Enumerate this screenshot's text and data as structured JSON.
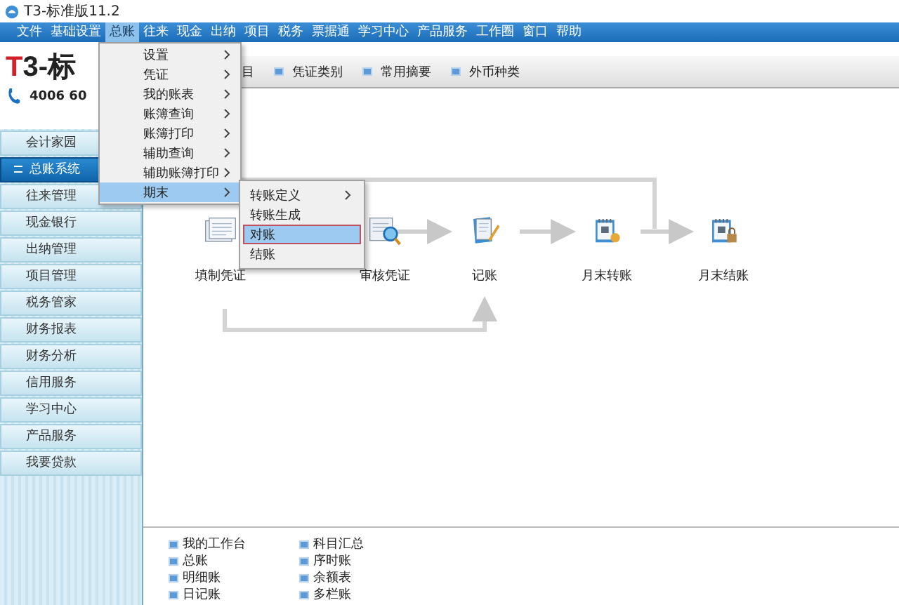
{
  "window": {
    "title": "T3-标准版11.2"
  },
  "menu_bar": [
    {
      "label": "文件",
      "selected": false
    },
    {
      "label": "基础设置",
      "selected": false
    },
    {
      "label": "总账",
      "selected": true
    },
    {
      "label": "往来",
      "selected": false
    },
    {
      "label": "现金",
      "selected": false
    },
    {
      "label": "出纳",
      "selected": false
    },
    {
      "label": "项目",
      "selected": false
    },
    {
      "label": "税务",
      "selected": false
    },
    {
      "label": "票据通",
      "selected": false
    },
    {
      "label": "学习中心",
      "selected": false
    },
    {
      "label": "产品服务",
      "selected": false
    },
    {
      "label": "工作圈",
      "selected": false
    },
    {
      "label": "窗口",
      "selected": false
    },
    {
      "label": "帮助",
      "selected": false
    }
  ],
  "header": {
    "logo_mark": "T",
    "logo_text": "3-标",
    "phone": "4006 60"
  },
  "toolbar": [
    {
      "label": "目",
      "bullet": false
    },
    {
      "label": "凭证类别",
      "bullet": true
    },
    {
      "label": "常用摘要",
      "bullet": true
    },
    {
      "label": "外币种类",
      "bullet": true
    }
  ],
  "sidebar": {
    "items": [
      {
        "label": "会计家园",
        "selected": false
      },
      {
        "label": "总账系统",
        "selected": true
      },
      {
        "label": "往来管理",
        "selected": false
      },
      {
        "label": "现金银行",
        "selected": false
      },
      {
        "label": "出纳管理",
        "selected": false
      },
      {
        "label": "项目管理",
        "selected": false
      },
      {
        "label": "税务管家",
        "selected": false
      },
      {
        "label": "财务报表",
        "selected": false
      },
      {
        "label": "财务分析",
        "selected": false
      },
      {
        "label": "信用服务",
        "selected": false
      },
      {
        "label": "学习中心",
        "selected": false
      },
      {
        "label": "产品服务",
        "selected": false
      },
      {
        "label": "我要贷款",
        "selected": false
      }
    ]
  },
  "dropdown": {
    "items": [
      {
        "label": "设置",
        "has_submenu": true,
        "selected": false
      },
      {
        "label": "凭证",
        "has_submenu": true,
        "selected": false
      },
      {
        "label": "我的账表",
        "has_submenu": true,
        "selected": false
      },
      {
        "label": "账簿查询",
        "has_submenu": true,
        "selected": false
      },
      {
        "label": "账簿打印",
        "has_submenu": true,
        "selected": false
      },
      {
        "label": "辅助查询",
        "has_submenu": true,
        "selected": false
      },
      {
        "label": "辅助账簿打印",
        "has_submenu": true,
        "selected": false
      },
      {
        "label": "期末",
        "has_submenu": true,
        "selected": true
      }
    ]
  },
  "submenu": {
    "items": [
      {
        "label": "转账定义",
        "has_submenu": true,
        "selected": false
      },
      {
        "label": "转账生成",
        "has_submenu": false,
        "selected": false
      },
      {
        "label": "对账",
        "has_submenu": false,
        "selected": true
      },
      {
        "label": "结账",
        "has_submenu": false,
        "selected": false
      }
    ]
  },
  "flow": {
    "nodes": [
      {
        "label": "填制凭证",
        "kind": "document"
      },
      {
        "label": "审核凭证",
        "kind": "review"
      },
      {
        "label": "记账",
        "kind": "notebook"
      },
      {
        "label": "月末转账",
        "kind": "calendar"
      },
      {
        "label": "月末结账",
        "kind": "calendar-lock"
      }
    ]
  },
  "quick_links": [
    [
      "我的工作台",
      "总账",
      "明细账",
      "日记账"
    ],
    [
      "科目汇总",
      "序时账",
      "余额表",
      "多栏账"
    ]
  ]
}
